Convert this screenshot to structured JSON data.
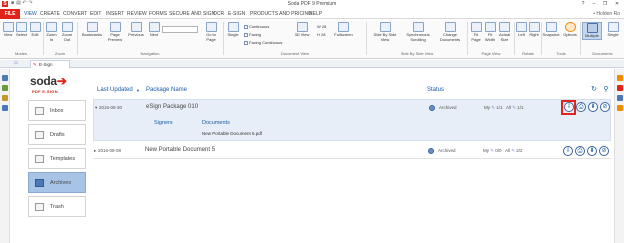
{
  "window": {
    "app_icon": "S",
    "title": "Soda PDF 9 Premium",
    "user": "Holden Ro",
    "controls": [
      "?",
      "–",
      "❐",
      "✕"
    ]
  },
  "menu": {
    "file": "FILE",
    "items": [
      "VIEW",
      "CREATE",
      "CONVERT",
      "EDIT",
      "INSERT",
      "REVIEW",
      "FORMS",
      "SECURE AND SIGN",
      "OCR",
      "E-SIGN",
      "PRODUCTS AND PRICING",
      "HELP"
    ],
    "active": "VIEW"
  },
  "ribbon": {
    "buttons": [
      "View",
      "Select",
      "Edit",
      "Zoom In",
      "Zoom Out",
      "Bookmarks",
      "Page Preview",
      "Previous",
      "Next",
      "Go to Page",
      "Single",
      "3D View",
      "Fullscreen",
      "Side By Side View",
      "Synchronous Scrolling",
      "Change Documents",
      "Fit Page",
      "Fit Width",
      "Actual Size",
      "Left",
      "Right",
      "Snapshot",
      "Options",
      "Multiple",
      "Single"
    ],
    "options": [
      "Continuous",
      "Facing",
      "Facing Continuous"
    ],
    "zoom_mini": [
      "W",
      "28",
      "H",
      "28"
    ],
    "groups": [
      "Modes",
      "Zoom",
      "Navigation",
      "Document View",
      "Side By Side View",
      "Page View",
      "Rotate",
      "Tools",
      "Documents"
    ]
  },
  "tab": {
    "label": "E-Sign Manager"
  },
  "brand": {
    "name": "soda",
    "arrow": "➔",
    "sub": "PDF E-SIGN"
  },
  "nav": {
    "items": [
      {
        "label": "Inbox"
      },
      {
        "label": "Drafts"
      },
      {
        "label": "Templates"
      },
      {
        "label": "Archives"
      },
      {
        "label": "Trash"
      }
    ]
  },
  "table": {
    "headers": {
      "last_updated": "Last Updated",
      "sort_arrow": "▼",
      "package_name": "Package Name",
      "status": "Status"
    },
    "header_icons": {
      "refresh": "↻",
      "search": "⚲"
    },
    "rows": [
      {
        "toggle": "▾",
        "date": "2016-08-30",
        "name": "eSign Package 010",
        "status": "Archived",
        "my": "My",
        "my_count": "1/1",
        "all": "All",
        "all_count": "1/1",
        "signers_label": "Signers",
        "documents_label": "Documents",
        "document": "New Portable Document 6.pdf"
      },
      {
        "toggle": "▸",
        "date": "2016-08-08",
        "name": "New Portable Document 5",
        "status": "Archived",
        "my": "My",
        "my_count": "0/0",
        "all": "All",
        "all_count": "2/2"
      }
    ]
  },
  "action_glyphs": [
    "⇩",
    "⎙",
    "⬇",
    "⊘"
  ],
  "colors": {
    "brand_red": "#e2231a",
    "link_blue": "#1a5aa6",
    "selected_row": "#e7eef7",
    "active_nav": "#a7c4e6"
  }
}
